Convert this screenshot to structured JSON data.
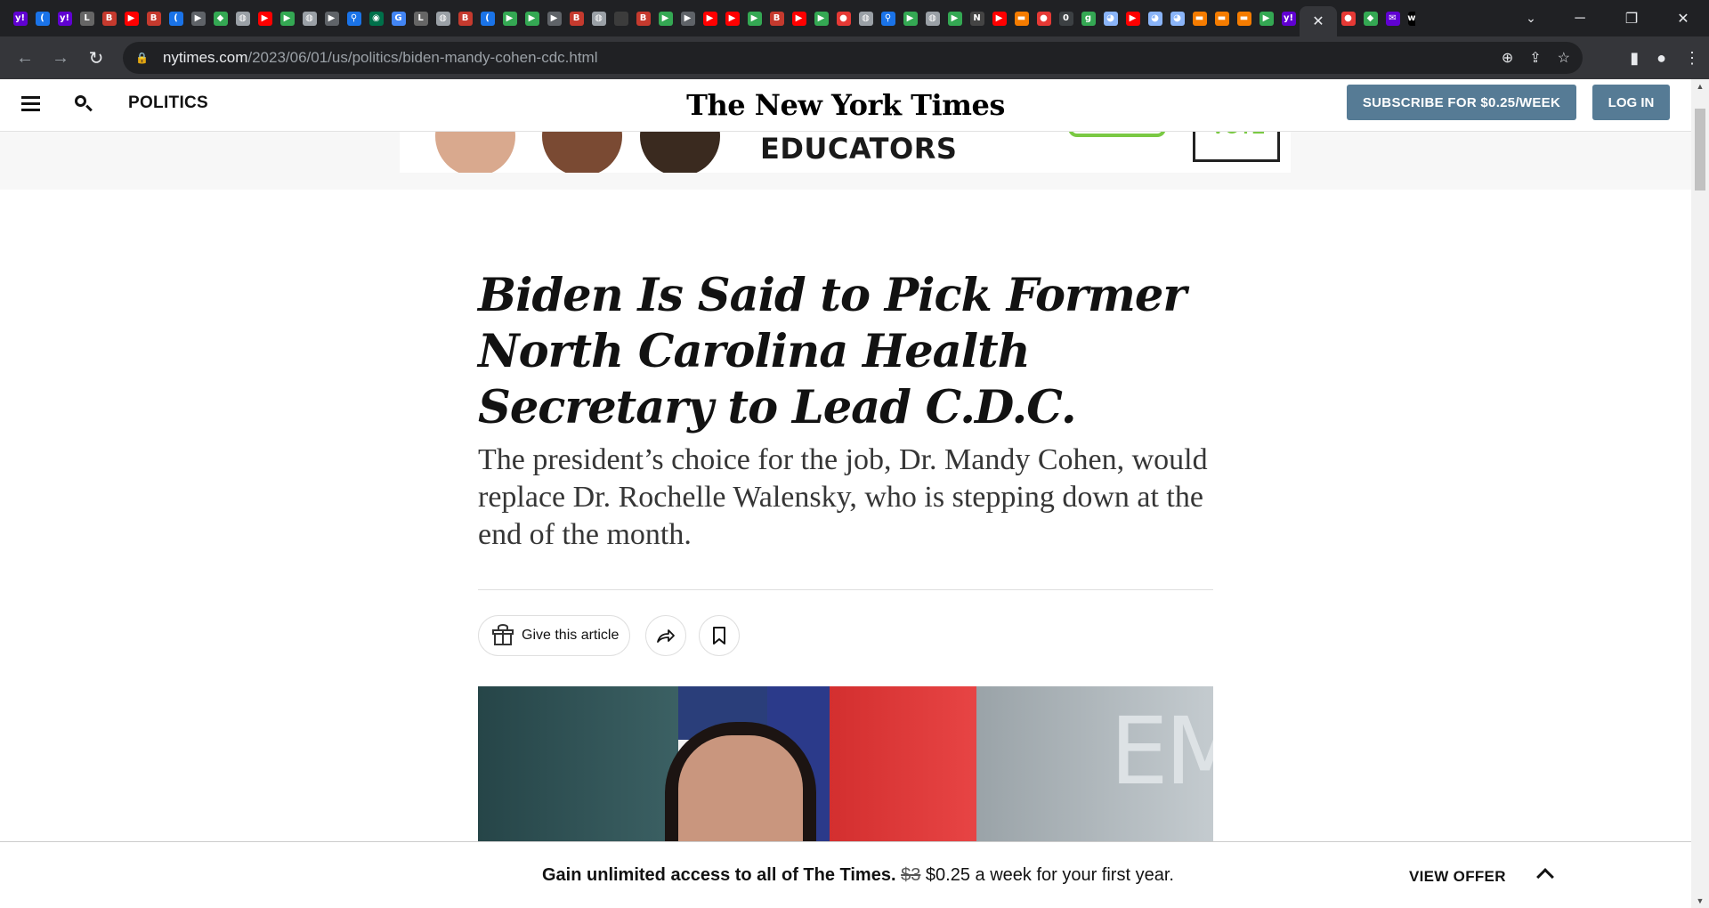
{
  "browser": {
    "tab_favicons": [
      {
        "name": "yahoo-icon",
        "glyph": "y!",
        "color": "#6001d2"
      },
      {
        "name": "blue-chevron-icon",
        "glyph": "(",
        "color": "#1a73e8"
      },
      {
        "name": "yahoo-icon",
        "glyph": "y!",
        "color": "#6001d2"
      },
      {
        "name": "latimes-icon",
        "glyph": "L",
        "color": "#666666"
      },
      {
        "name": "bi-icon",
        "glyph": "B",
        "color": "#c53a2e"
      },
      {
        "name": "youtube-icon",
        "glyph": "▶",
        "color": "#ff0000"
      },
      {
        "name": "bi-icon",
        "glyph": "B",
        "color": "#c53a2e"
      },
      {
        "name": "blue-chevron-icon",
        "glyph": "(",
        "color": "#1a73e8"
      },
      {
        "name": "grey-arrow-icon",
        "glyph": "▶",
        "color": "#5f6368"
      },
      {
        "name": "maps-icon",
        "glyph": "◆",
        "color": "#34a853"
      },
      {
        "name": "globe-icon",
        "glyph": "◍",
        "color": "#9aa0a6"
      },
      {
        "name": "youtube-icon",
        "glyph": "▶",
        "color": "#ff0000"
      },
      {
        "name": "play-icon",
        "glyph": "▶",
        "color": "#34a853"
      },
      {
        "name": "globe-icon",
        "glyph": "◍",
        "color": "#9aa0a6"
      },
      {
        "name": "grey-arrow-icon",
        "glyph": "▶",
        "color": "#5f6368"
      },
      {
        "name": "search-tab-icon",
        "glyph": "⚲",
        "color": "#1a73e8"
      },
      {
        "name": "starbucks-icon",
        "glyph": "◉",
        "color": "#00704a"
      },
      {
        "name": "google-icon",
        "glyph": "G",
        "color": "#4285f4"
      },
      {
        "name": "latimes-icon",
        "glyph": "L",
        "color": "#666666"
      },
      {
        "name": "globe-icon",
        "glyph": "◍",
        "color": "#9aa0a6"
      },
      {
        "name": "bi-icon",
        "glyph": "B",
        "color": "#c53a2e"
      },
      {
        "name": "blue-chevron-icon",
        "glyph": "(",
        "color": "#1a73e8"
      },
      {
        "name": "play-icon",
        "glyph": "▶",
        "color": "#34a853"
      },
      {
        "name": "play-icon",
        "glyph": "▶",
        "color": "#34a853"
      },
      {
        "name": "grey-arrow-icon",
        "glyph": "▶",
        "color": "#5f6368"
      },
      {
        "name": "bi-icon",
        "glyph": "B",
        "color": "#c53a2e"
      },
      {
        "name": "globe-icon",
        "glyph": "◍",
        "color": "#9aa0a6"
      },
      {
        "name": "blank-tab-icon",
        "glyph": "",
        "color": "#3c3c3c"
      },
      {
        "name": "bi-icon",
        "glyph": "B",
        "color": "#c53a2e"
      },
      {
        "name": "play-icon",
        "glyph": "▶",
        "color": "#34a853"
      },
      {
        "name": "grey-arrow-icon",
        "glyph": "▶",
        "color": "#5f6368"
      },
      {
        "name": "youtube-icon",
        "glyph": "▶",
        "color": "#ff0000"
      },
      {
        "name": "youtube-icon",
        "glyph": "▶",
        "color": "#ff0000"
      },
      {
        "name": "play-icon",
        "glyph": "▶",
        "color": "#34a853"
      },
      {
        "name": "bi-icon",
        "glyph": "B",
        "color": "#c53a2e"
      },
      {
        "name": "youtube-icon",
        "glyph": "▶",
        "color": "#ff0000"
      },
      {
        "name": "play-icon",
        "glyph": "▶",
        "color": "#34a853"
      },
      {
        "name": "podcast-icon",
        "glyph": "●",
        "color": "#e53935"
      },
      {
        "name": "globe-icon",
        "glyph": "◍",
        "color": "#9aa0a6"
      },
      {
        "name": "search-tab-icon",
        "glyph": "⚲",
        "color": "#1a73e8"
      },
      {
        "name": "play-icon",
        "glyph": "▶",
        "color": "#34a853"
      },
      {
        "name": "globe-icon",
        "glyph": "◍",
        "color": "#9aa0a6"
      },
      {
        "name": "play-icon",
        "glyph": "▶",
        "color": "#34a853"
      },
      {
        "name": "news-icon",
        "glyph": "N",
        "color": "#444444"
      },
      {
        "name": "youtube-icon",
        "glyph": "▶",
        "color": "#ff0000"
      },
      {
        "name": "bookmark-orange-icon",
        "glyph": "▬",
        "color": "#f57c00"
      },
      {
        "name": "podcast-icon",
        "glyph": "●",
        "color": "#e53935"
      },
      {
        "name": "circle-dark-icon",
        "glyph": "0",
        "color": "#3c4043"
      },
      {
        "name": "green-g-icon",
        "glyph": "g",
        "color": "#34a853"
      },
      {
        "name": "portrait-icon",
        "glyph": "◕",
        "color": "#8ab4f8"
      },
      {
        "name": "youtube-icon",
        "glyph": "▶",
        "color": "#ff0000"
      },
      {
        "name": "portrait-icon",
        "glyph": "◕",
        "color": "#8ab4f8"
      },
      {
        "name": "portrait-icon",
        "glyph": "◕",
        "color": "#8ab4f8"
      },
      {
        "name": "bookmark-orange-icon",
        "glyph": "▬",
        "color": "#f57c00"
      },
      {
        "name": "bookmark-orange-icon",
        "glyph": "▬",
        "color": "#f57c00"
      },
      {
        "name": "bookmark-orange-icon",
        "glyph": "▬",
        "color": "#f57c00"
      },
      {
        "name": "play-icon",
        "glyph": "▶",
        "color": "#34a853"
      },
      {
        "name": "yahoo-icon",
        "glyph": "y!",
        "color": "#6001d2"
      }
    ],
    "active_tab_close": "✕",
    "after_tabs_favicons": [
      {
        "name": "podcast-icon",
        "glyph": "●",
        "color": "#e53935"
      },
      {
        "name": "maps-icon",
        "glyph": "◆",
        "color": "#34a853"
      },
      {
        "name": "yahoo-mail-icon",
        "glyph": "✉",
        "color": "#6001d2"
      },
      {
        "name": "washington-post-icon",
        "glyph": "wp",
        "color": "#000000"
      }
    ],
    "new_tab": "+",
    "tab_search": "⌄",
    "window_controls": {
      "minimize": "─",
      "restore": "❐",
      "close": "✕"
    },
    "nav": {
      "back": "←",
      "forward": "→",
      "reload": "↻"
    },
    "url_host": "nytimes.com",
    "url_path": "/2023/06/01/us/politics/biden-mandy-cohen-cdc.html",
    "lock_icon": "🔒",
    "omnibox_icons": {
      "zoom": "⊕",
      "share": "⇪",
      "star": "☆"
    },
    "toolbar_right": {
      "sidebar": "▮",
      "profile": "●",
      "menu": "⋮"
    }
  },
  "masthead": {
    "section": "POLITICS",
    "logo": "The New York Times",
    "subscribe_label": "SUBSCRIBE FOR $0.25/WEEK",
    "login_label": "LOG IN"
  },
  "ad": {
    "text": "EDUCATORS",
    "box_text": "VOTE"
  },
  "article": {
    "headline": "Biden Is Said to Pick Former North Carolina Health Secretary to Lead C.D.C.",
    "summary": "The president’s choice for the job, Dr. Mandy Cohen, would replace Dr. Rochelle Walensky, who is stepping down at the end of the month.",
    "gift_label": "Give this article",
    "hero_letters": "EM"
  },
  "offer_bar": {
    "lead": "Gain unlimited access to all of The Times.",
    "old_price": "$3",
    "new_price": "$0.25 a week for your first year.",
    "cta": "VIEW OFFER"
  },
  "colors": {
    "chrome_dark": "#202124",
    "chrome_toolbar": "#35363a",
    "nyt_button": "#567b95",
    "text": "#121212"
  }
}
